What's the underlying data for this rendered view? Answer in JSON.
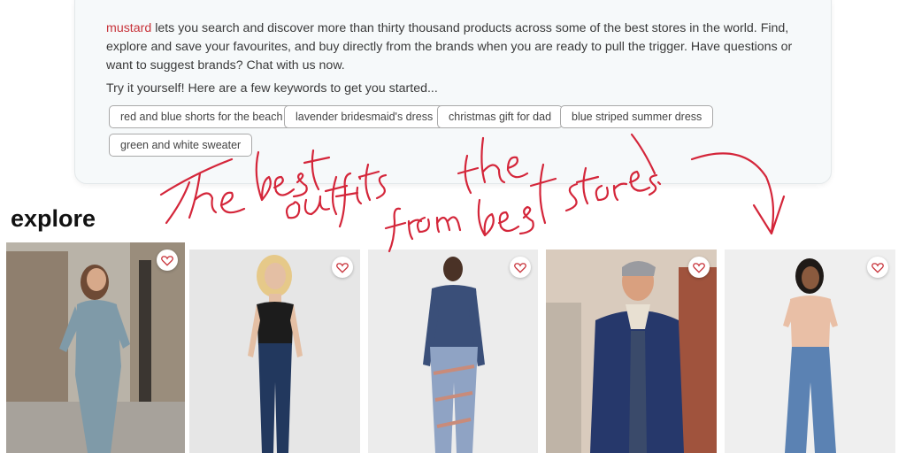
{
  "intro": {
    "brand_name": "mustard",
    "description": " lets you search and discover more than thirty thousand products across some of the best stores in the world. Find, explore and save your favourites, and buy directly from the brands when you are ready to pull the trigger. Have questions or want to suggest brands? Chat with us now.",
    "prompt": "Try it yourself! Here are a few keywords to get you started..."
  },
  "keywords": [
    "red and blue shorts for the beach",
    "lavender bridesmaid's dress",
    "christmas gift for dad",
    "blue striped summer dress",
    "green and white sweater"
  ],
  "explore": {
    "title": "explore",
    "products": [
      {
        "description": "woman in blue jumpsuit on city street",
        "icon": "heart-icon"
      },
      {
        "description": "woman in black bodysuit and dark skinny jeans",
        "icon": "heart-icon"
      },
      {
        "description": "man in navy henley and patterned pants",
        "icon": "heart-icon"
      },
      {
        "description": "man in navy sherpa-lined jacket",
        "icon": "heart-icon"
      },
      {
        "description": "woman in peach top and flared jeans",
        "icon": "heart-icon"
      }
    ]
  },
  "annotation": {
    "handwritten_text": "The best outfits from the best stores!",
    "color": "#d4263a"
  },
  "colors": {
    "brand": "#c8343b",
    "card_bg": "#f6f9fa",
    "heart": "#c8343b"
  }
}
